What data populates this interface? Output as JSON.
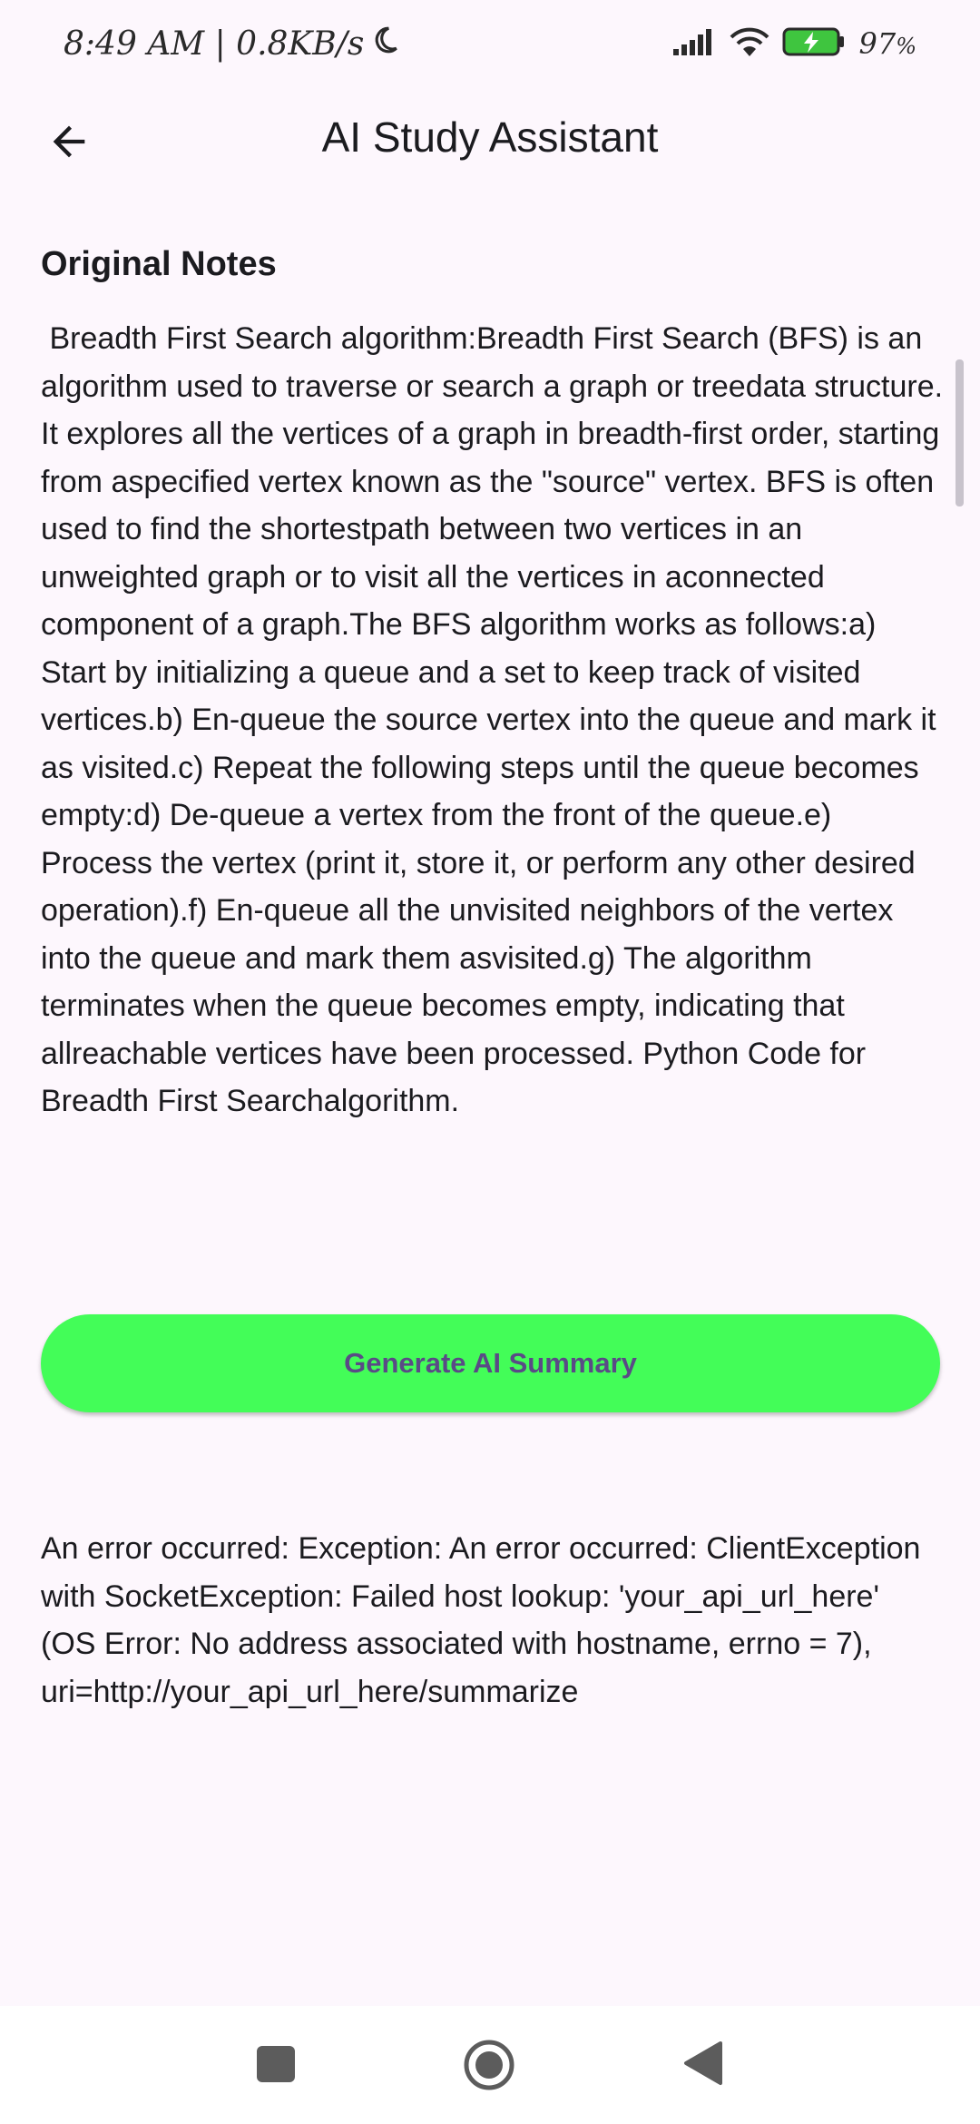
{
  "status_bar": {
    "time": "8:49 AM | 0.8KB/s",
    "battery_percent": "97",
    "battery_unit": "%",
    "icons": [
      "moon-icon",
      "signal-icon",
      "wifi-icon",
      "battery-charging-icon"
    ]
  },
  "app_bar": {
    "title": "AI Study Assistant",
    "back_icon": "arrow-left-icon"
  },
  "notes_section": {
    "title": "Original Notes",
    "body": " Breadth First Search algorithm:Breadth First Search (BFS) is an algorithm used to traverse or search a graph or treedata structure. It explores all the vertices of a graph in breadth-first order, starting from aspecified vertex known as the \"source\" vertex. BFS is often used to find the shortestpath between two vertices in an unweighted graph or to visit all the vertices in aconnected component of a graph.The BFS algorithm works as follows:a) Start by initializing a queue and a set to keep track of visited vertices.b) En-queue the source vertex into the queue and mark it as visited.c) Repeat the following steps until the queue becomes empty:d) De-queue a vertex from the front of the queue.e) Process the vertex (print it, store it, or perform any other desired operation).f) En-queue all the unvisited neighbors of the vertex into the queue and mark them asvisited.g) The algorithm terminates when the queue becomes empty, indicating that allreachable vertices have been processed. Python Code for Breadth First Searchalgorithm."
  },
  "generate_button": {
    "label": "Generate AI Summary",
    "color": "#43fd58"
  },
  "error_message": "An error occurred: Exception: An error occurred: ClientException with SocketException: Failed host lookup: 'your_api_url_here' (OS Error: No address associated with hostname, errno = 7), uri=http://your_api_url_here/summarize",
  "nav_bar": {
    "icons": [
      "recents-square-icon",
      "home-circle-icon",
      "back-triangle-icon"
    ]
  }
}
